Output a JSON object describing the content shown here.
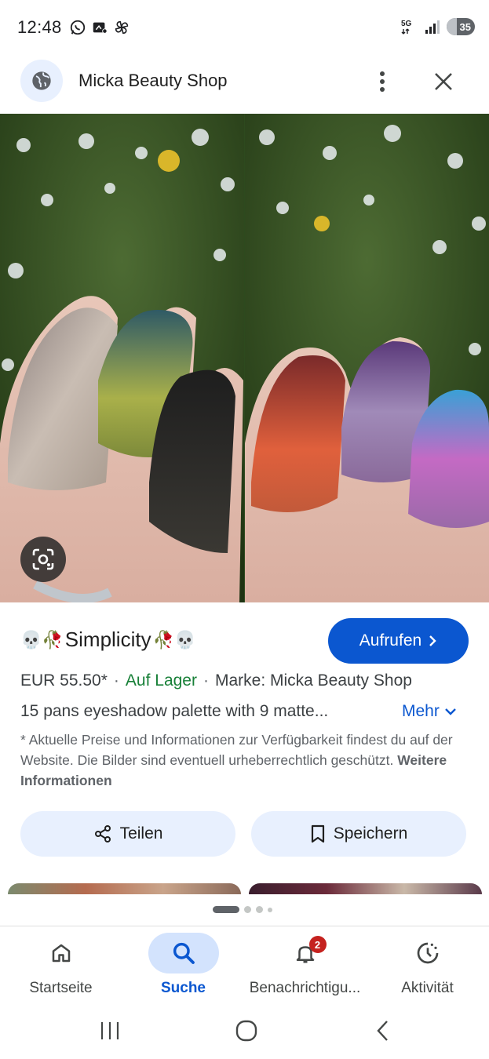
{
  "status_bar": {
    "time": "12:48",
    "battery_level": "35",
    "network": "5G"
  },
  "header": {
    "site_name": "Micka Beauty Shop"
  },
  "product": {
    "title": "Simplicity",
    "title_emoji_left": "💀🥀",
    "title_emoji_right": "🥀💀",
    "visit_label": "Aufrufen",
    "price": "EUR 55.50*",
    "stock": "Auf Lager",
    "brand": "Marke: Micka Beauty Shop",
    "description": "15 pans eyeshadow palette with 9 matte...",
    "more_label": "Mehr",
    "disclaimer": "* Aktuelle Preise und Informationen zur Verfügbarkeit findest du auf der Website. Die Bilder sind eventuell urheberrechtlich geschützt.",
    "more_info_link": "Weitere Informationen"
  },
  "actions": {
    "share_label": "Teilen",
    "save_label": "Speichern"
  },
  "bottom_nav": {
    "items": [
      {
        "label": "Startseite",
        "icon": "home-icon"
      },
      {
        "label": "Suche",
        "icon": "search-icon",
        "active": true
      },
      {
        "label": "Benachrichtigu...",
        "icon": "bell-icon",
        "badge": "2"
      },
      {
        "label": "Aktivität",
        "icon": "activity-icon"
      }
    ]
  },
  "colors": {
    "accent": "#0b57d0",
    "stock_green": "#188038",
    "tonal_button": "#e8f0fe",
    "active_nav_pill": "#d3e3fd",
    "badge_red": "#c5221f"
  }
}
